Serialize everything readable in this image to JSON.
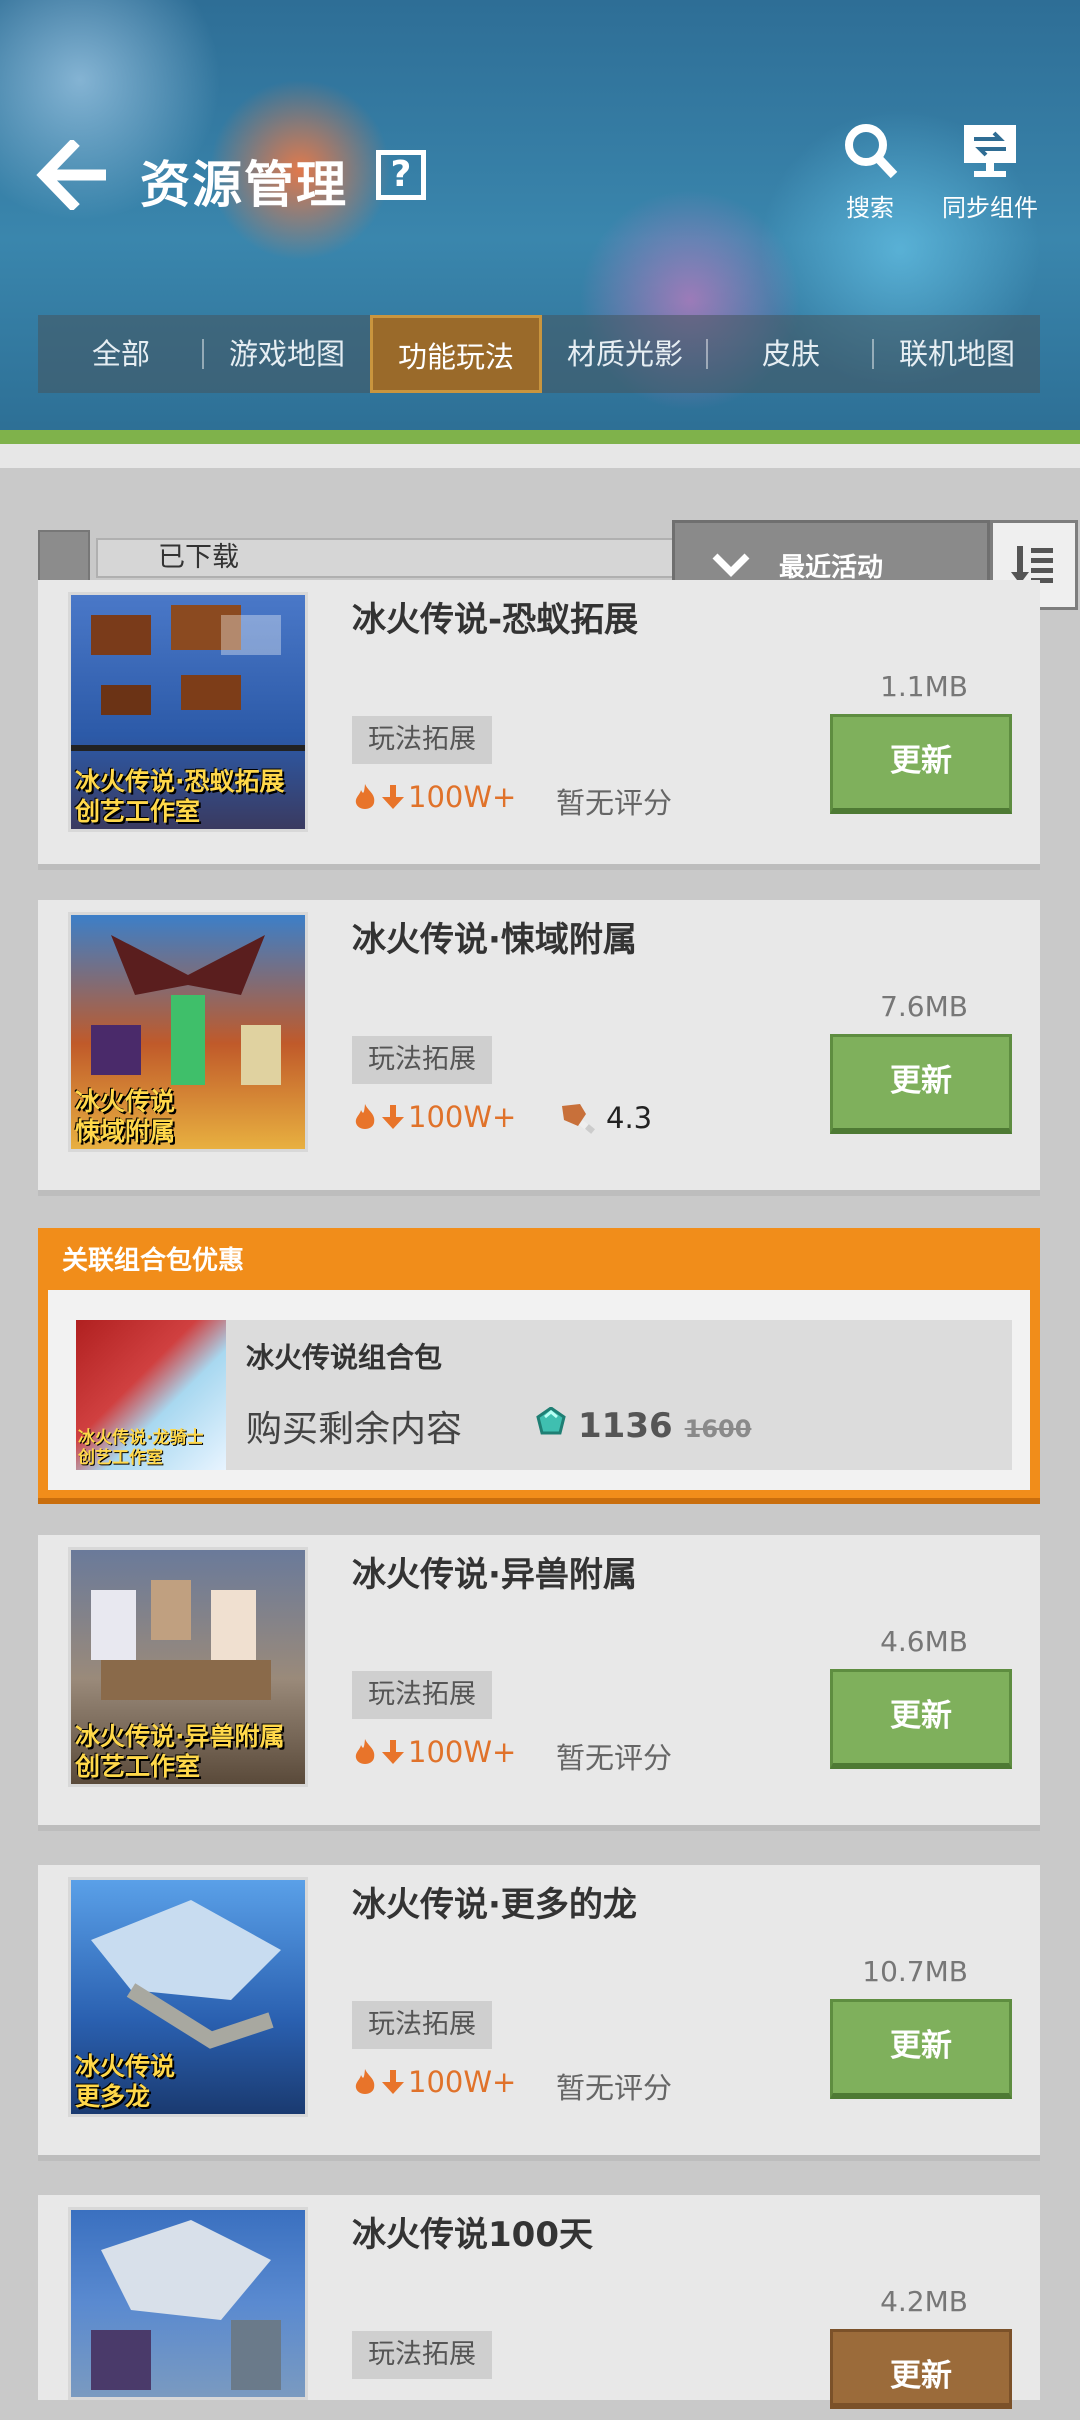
{
  "header": {
    "title": "资源管理",
    "help_label": "?",
    "search_label": "搜索",
    "sync_label": "同步组件"
  },
  "tabs": [
    {
      "label": "全部",
      "active": false
    },
    {
      "label": "游戏地图",
      "active": false
    },
    {
      "label": "功能玩法",
      "active": true
    },
    {
      "label": "材质光影",
      "active": false
    },
    {
      "label": "皮肤",
      "active": false
    },
    {
      "label": "联机地图",
      "active": false
    }
  ],
  "panel": {
    "label": "已下载",
    "sort_label": "最近活动"
  },
  "items": [
    {
      "title": "冰火传说-恐蚁拓展",
      "size": "1.1MB",
      "tag": "玩法拓展",
      "downloads": "100W+",
      "rating": "暂无评分",
      "button": "更新",
      "thumb_caption_1": "冰火传说·恐蚁拓展",
      "thumb_caption_2": "创艺工作室"
    },
    {
      "title": "冰火传说·悚域附属",
      "size": "7.6MB",
      "tag": "玩法拓展",
      "downloads": "100W+",
      "rating": "4.3",
      "button": "更新",
      "thumb_caption_1": "冰火传说",
      "thumb_caption_2": "悚域附属"
    },
    {
      "title": "冰火传说·异兽附属",
      "size": "4.6MB",
      "tag": "玩法拓展",
      "downloads": "100W+",
      "rating": "暂无评分",
      "button": "更新",
      "thumb_caption_1": "冰火传说·异兽附属",
      "thumb_caption_2": "创艺工作室"
    },
    {
      "title": "冰火传说·更多的龙",
      "size": "10.7MB",
      "tag": "玩法拓展",
      "downloads": "100W+",
      "rating": "暂无评分",
      "button": "更新",
      "thumb_caption_1": "冰火传说",
      "thumb_caption_2": "更多龙"
    },
    {
      "title": "冰火传说100天",
      "size": "4.2MB",
      "tag": "玩法拓展",
      "downloads": "",
      "rating": "",
      "button": "更新",
      "thumb_caption_1": "",
      "thumb_caption_2": ""
    }
  ],
  "bundle": {
    "title": "关联组合包优惠",
    "name": "冰火传说组合包",
    "buy_label": "购买剩余内容",
    "price_now": "1136",
    "price_old": "1600",
    "thumb_caption_1": "冰火传说·龙骑士",
    "thumb_caption_2": "创艺工作室"
  },
  "colors": {
    "accent_green": "#7fb05c",
    "bundle_orange": "#f18d1a",
    "tab_active": "#9a6a2a"
  },
  "icons": [
    "back-arrow-icon",
    "help-icon",
    "search-icon",
    "sync-icon",
    "chevron-down-icon",
    "sort-icon",
    "fire-icon",
    "download-arrow-icon",
    "meat-icon",
    "diamond-icon"
  ]
}
